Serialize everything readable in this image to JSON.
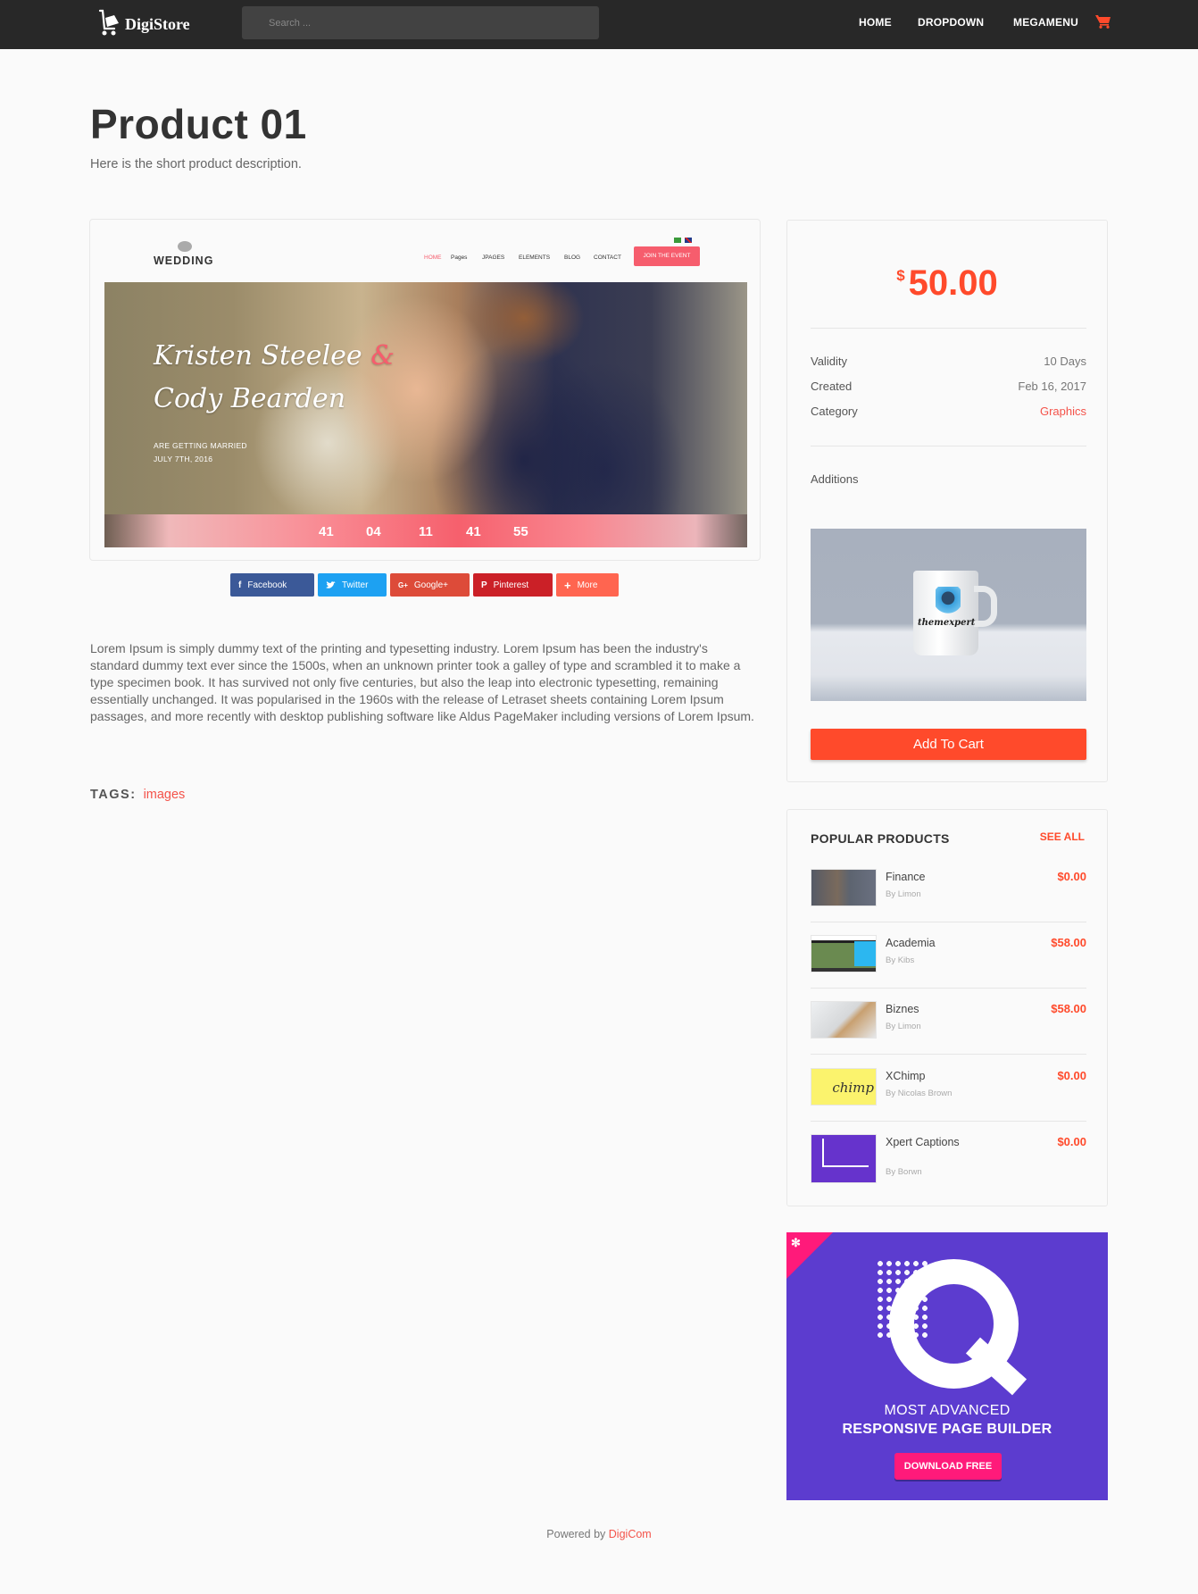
{
  "header": {
    "brand": "DigiStore",
    "search_placeholder": "Search ...",
    "nav": [
      {
        "label": "HOME"
      },
      {
        "label": "DROPDOWN"
      },
      {
        "label": "MEGAMENU"
      }
    ],
    "cart_icon": "shopping-cart-icon",
    "accent_color": "#ff4a2b"
  },
  "product": {
    "title": "Product 01",
    "short_description": "Here is the short product description.",
    "preview": {
      "site_logo": "WEDDING",
      "nav": [
        "HOME",
        "Pages",
        "JPAGES",
        "ELEMENTS",
        "BLOG",
        "CONTACT"
      ],
      "cta": "JOIN THE EVENT",
      "names_line1": "Kristen Steelee",
      "ampersand": "&",
      "names_line2": "Cody Bearden",
      "subtitle": "ARE GETTING MARRIED",
      "date": "JULY 7TH, 2016",
      "countdown": [
        "41",
        "04",
        "11",
        "41",
        "55"
      ]
    },
    "share": [
      {
        "label": "Facebook",
        "icon": "facebook-icon",
        "glyph": "f"
      },
      {
        "label": "Twitter",
        "icon": "twitter-icon",
        "glyph": "🐦"
      },
      {
        "label": "Google+",
        "icon": "google-plus-icon",
        "glyph": "G+"
      },
      {
        "label": "Pinterest",
        "icon": "pinterest-icon",
        "glyph": "P"
      },
      {
        "label": "More",
        "icon": "plus-icon",
        "glyph": "+"
      }
    ],
    "long_description": "Lorem Ipsum is simply dummy text of the printing and typesetting industry. Lorem Ipsum has been the industry's standard dummy text ever since the 1500s, when an unknown printer took a galley of type and scrambled it to make a type specimen book. It has survived not only five centuries, but also the leap into electronic typesetting, remaining essentially unchanged. It was popularised in the 1960s with the release of Letraset sheets containing Lorem Ipsum passages, and more recently with desktop publishing software like Aldus PageMaker including versions of Lorem Ipsum.",
    "tags_label": "TAGS:",
    "tags": [
      "images"
    ]
  },
  "purchase": {
    "currency_symbol": "$",
    "price": "50.00",
    "meta": [
      {
        "key": "Validity",
        "value": "10 Days"
      },
      {
        "key": "Created",
        "value": "Feb 16, 2017"
      },
      {
        "key": "Category",
        "value": "Graphics"
      }
    ],
    "additions_label": "Additions",
    "addition_image_text": "themexpert",
    "add_to_cart": "Add To Cart"
  },
  "popular": {
    "title": "POPULAR PRODUCTS",
    "see_all": "SEE ALL",
    "items": [
      {
        "name": "Finance",
        "author": "By Limon",
        "price": "$0.00"
      },
      {
        "name": "Academia",
        "author": "By Kibs",
        "price": "$58.00"
      },
      {
        "name": "Biznes",
        "author": "By Limon",
        "price": "$58.00"
      },
      {
        "name": "XChimp",
        "author": "By Nicolas Brown",
        "price": "$0.00",
        "thumb_text": "chimp"
      },
      {
        "name": "Xpert Captions",
        "author": "By Borwn",
        "price": "$0.00"
      }
    ]
  },
  "ad": {
    "line1": "MOST ADVANCED",
    "line2": "RESPONSIVE PAGE BUILDER",
    "button": "DOWNLOAD FREE",
    "corner_icon": "joomla-icon",
    "bg_color": "#5c3ccf",
    "accent_color": "#ff1a7a"
  },
  "footer": {
    "text": "Powered by",
    "link": "DigiCom"
  }
}
